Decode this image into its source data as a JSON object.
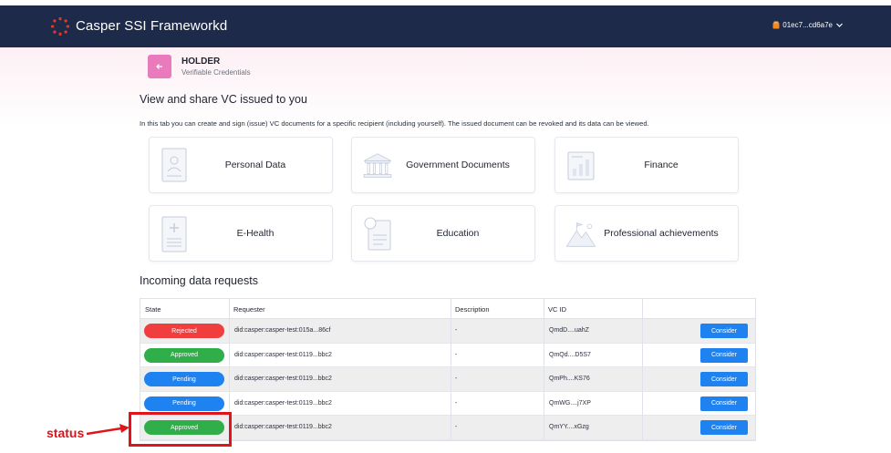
{
  "navbar": {
    "brand": "Casper SSI Frameworkd",
    "account": "01ec7...cd6a7e",
    "colors": {
      "bg": "#1e2a49",
      "logo": "#e0392b",
      "wallet": "#f08a24"
    }
  },
  "header": {
    "title": "HOLDER",
    "subtitle": "Verifiable Credentials",
    "back_icon": "arrow-left-icon"
  },
  "main": {
    "title": "View and share VC issued to you",
    "intro": "In this tab you can create and sign (issue) VC documents for a specific recipient (including yourself). The issued document can be revoked and its data can be viewed.",
    "cards": [
      {
        "label": "Personal Data",
        "icon": "id-card-icon"
      },
      {
        "label": "Government Documents",
        "icon": "government-building-icon"
      },
      {
        "label": "Finance",
        "icon": "finance-chart-icon"
      },
      {
        "label": "E-Health",
        "icon": "medical-document-icon"
      },
      {
        "label": "Education",
        "icon": "graded-document-icon"
      },
      {
        "label": "Professional achievements",
        "icon": "mountain-flag-icon"
      }
    ]
  },
  "requests": {
    "title": "Incoming data requests",
    "columns": [
      "State",
      "Requester",
      "Description",
      "VC ID",
      ""
    ],
    "rows": [
      {
        "state": "Rejected",
        "state_color": "#f03e3e",
        "requester": "did:casper:casper-test:015a...86cf",
        "description": "-",
        "vc_id": "QmdD....uahZ",
        "action": "Consider"
      },
      {
        "state": "Approved",
        "state_color": "#2fae4a",
        "requester": "did:casper:casper-test:0119...bbc2",
        "description": "-",
        "vc_id": "QmQd....D5S7",
        "action": "Consider"
      },
      {
        "state": "Pending",
        "state_color": "#1e82f0",
        "requester": "did:casper:casper-test:0119...bbc2",
        "description": "-",
        "vc_id": "QmPh....KS76",
        "action": "Consider"
      },
      {
        "state": "Pending",
        "state_color": "#1e82f0",
        "requester": "did:casper:casper-test:0119...bbc2",
        "description": "-",
        "vc_id": "QmWG....j7XP",
        "action": "Consider"
      },
      {
        "state": "Approved",
        "state_color": "#2fae4a",
        "requester": "did:casper:casper-test:0119...bbc2",
        "description": "-",
        "vc_id": "QmYY....xGzg",
        "action": "Consider"
      }
    ]
  },
  "annotation": {
    "label": "status",
    "color": "#e0141b"
  }
}
